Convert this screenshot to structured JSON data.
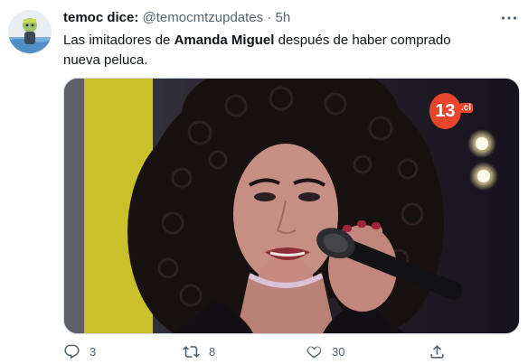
{
  "tweet": {
    "display_name": "temoc dice:",
    "handle": "@temocmtzupdates",
    "separator": "·",
    "time": "5h",
    "text_before": "Las imitadores de ",
    "text_bold": "Amanda Miguel",
    "text_after": " después de haber comprado nueva peluca.",
    "media": {
      "channel_logo": "13",
      "channel_logo_suffix": ".cl",
      "description_icon": "video-still-photo"
    }
  },
  "actions": {
    "reply_count": "3",
    "retweet_count": "8",
    "like_count": "30",
    "reply_icon": "reply-icon",
    "retweet_icon": "retweet-icon",
    "like_icon": "heart-icon",
    "share_icon": "share-icon"
  },
  "colors": {
    "text_primary": "#0f1419",
    "text_secondary": "#536471",
    "border": "#cfd9de",
    "channel_logo_orange": "#e8452c"
  }
}
